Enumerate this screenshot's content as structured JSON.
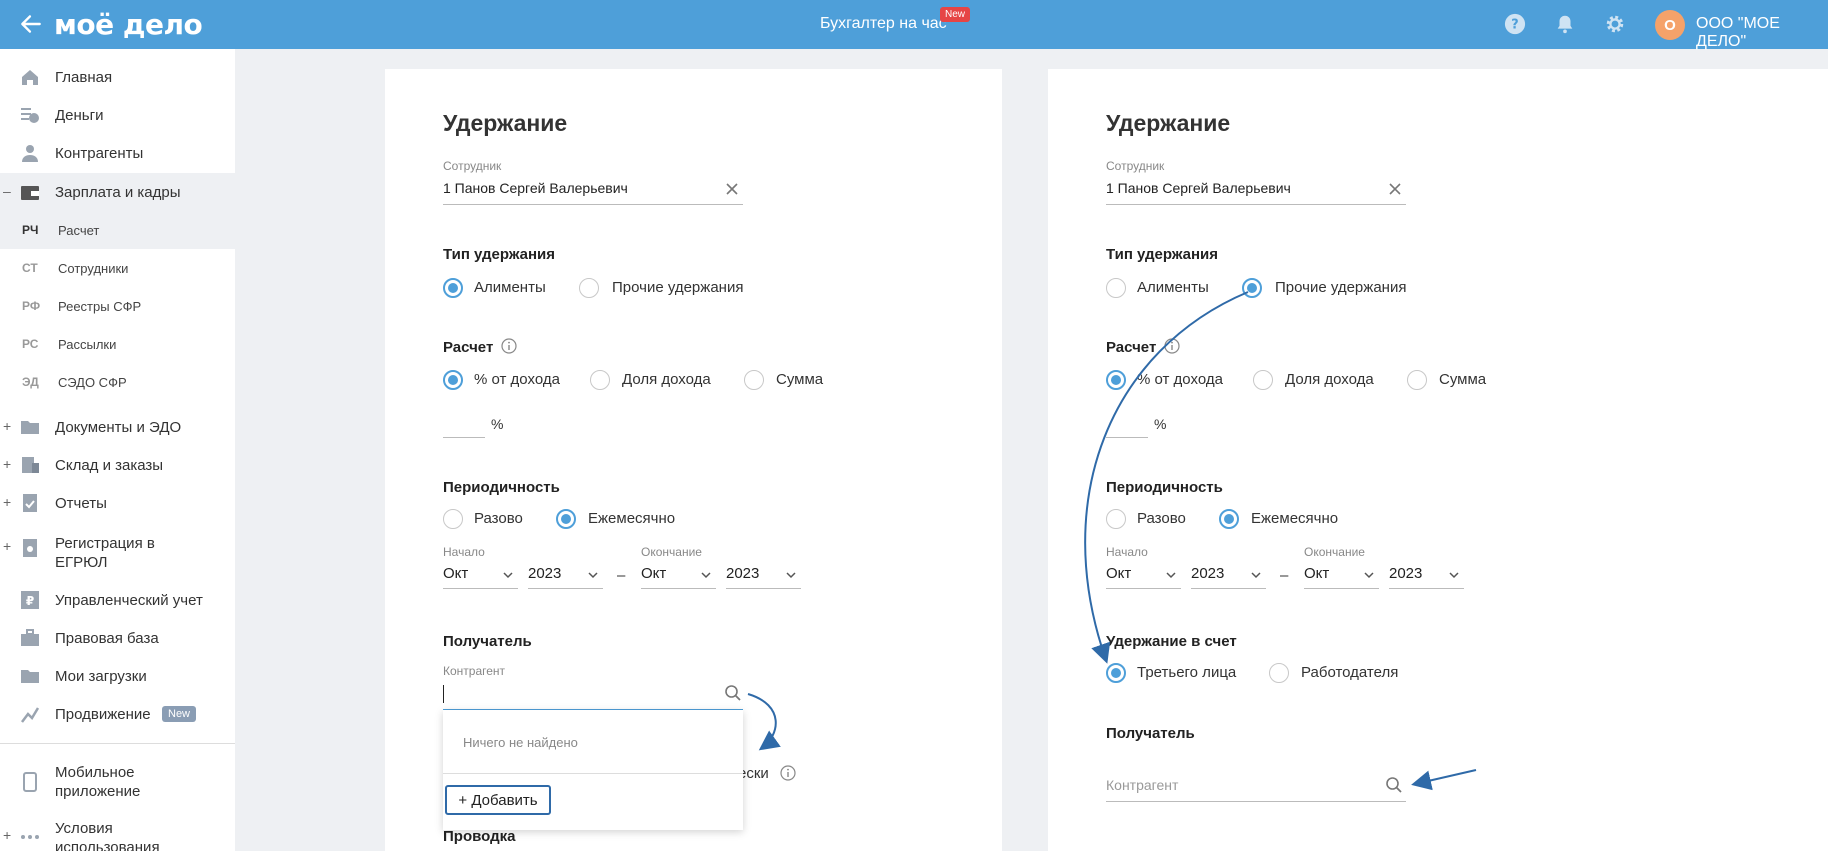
{
  "topbar": {
    "logo": "моё дело",
    "center_title": "Бухгалтер на час",
    "new_badge": "New",
    "avatar_letter": "О",
    "company": "ООО \"МОЕ ДЕЛО\""
  },
  "sidebar": {
    "items": [
      {
        "label": "Главная",
        "icon": "home-icon"
      },
      {
        "label": "Деньги",
        "icon": "money-icon"
      },
      {
        "label": "Контрагенты",
        "icon": "contractors-icon"
      },
      {
        "label": "Зарплата и кадры",
        "icon": "wallet-icon",
        "prefix": "–"
      },
      {
        "label": "Документы и ЭДО",
        "icon": "folder-icon",
        "prefix": "+"
      },
      {
        "label": "Склад и заказы",
        "icon": "warehouse-icon",
        "prefix": "+"
      },
      {
        "label": "Отчеты",
        "icon": "report-icon",
        "prefix": "+"
      },
      {
        "label": "Регистрация в",
        "label2": "ЕГРЮЛ",
        "icon": "registration-icon",
        "prefix": "+"
      },
      {
        "label": "Управленческий учет",
        "icon": "management-icon"
      },
      {
        "label": "Правовая база",
        "icon": "briefcase-icon"
      },
      {
        "label": "Мои загрузки",
        "icon": "downloads-icon"
      },
      {
        "label": "Продвижение",
        "icon": "promotion-icon",
        "badge": "New"
      },
      {
        "label": "Мобильное",
        "label2": "приложение",
        "icon": "mobile-icon"
      },
      {
        "label": "Условия",
        "label2": "использования",
        "icon": "dots-icon",
        "prefix": "+"
      }
    ],
    "subitems": [
      {
        "abbr": "РЧ",
        "label": "Расчет"
      },
      {
        "abbr": "СТ",
        "label": "Сотрудники"
      },
      {
        "abbr": "РФ",
        "label": "Реестры СФР"
      },
      {
        "abbr": "РС",
        "label": "Рассылки"
      },
      {
        "abbr": "ЭД",
        "label": "СЭДО СФР"
      }
    ]
  },
  "left_form": {
    "title": "Удержание",
    "employee_label": "Сотрудник",
    "employee_value": "1 Панов Сергей Валерьевич",
    "type_label": "Тип удержания",
    "type_opt1": "Алименты",
    "type_opt2": "Прочие удержания",
    "calc_label": "Расчет",
    "calc_opt1": "% от дохода",
    "calc_opt2": "Доля дохода",
    "calc_opt3": "Сумма",
    "pct": "%",
    "period_label": "Периодичность",
    "period_opt1": "Разово",
    "period_opt2": "Ежемесячно",
    "start_label": "Начало",
    "end_label": "Окончание",
    "start_month": "Окт",
    "start_year": "2023",
    "dash": "–",
    "end_month": "Окт",
    "end_year": "2023",
    "recipient_label": "Получатель",
    "contractor_label": "Контрагент",
    "dropdown_not_found": "Ничего не найдено",
    "dropdown_add": "+ Добавить",
    "partial_text": "ески",
    "posting_label": "Проводка"
  },
  "right_form": {
    "title": "Удержание",
    "employee_label": "Сотрудник",
    "employee_value": "1 Панов Сергей Валерьевич",
    "type_label": "Тип удержания",
    "type_opt1": "Алименты",
    "type_opt2": "Прочие удержания",
    "calc_label": "Расчет",
    "calc_opt1": "% от дохода",
    "calc_opt2": "Доля дохода",
    "calc_opt3": "Сумма",
    "pct": "%",
    "period_label": "Периодичность",
    "period_opt1": "Разово",
    "period_opt2": "Ежемесячно",
    "start_label": "Начало",
    "end_label": "Окончание",
    "start_month": "Окт",
    "start_year": "2023",
    "dash": "–",
    "end_month": "Окт",
    "end_year": "2023",
    "deduct_label": "Удержание в счет",
    "deduct_opt1": "Третьего лица",
    "deduct_opt2": "Работодателя",
    "recipient_label": "Получатель",
    "contractor_placeholder": "Контрагент"
  },
  "colors": {
    "topbar": "#4e9fd9",
    "accent": "#4e9fd9",
    "arrow": "#2f6aa8"
  }
}
